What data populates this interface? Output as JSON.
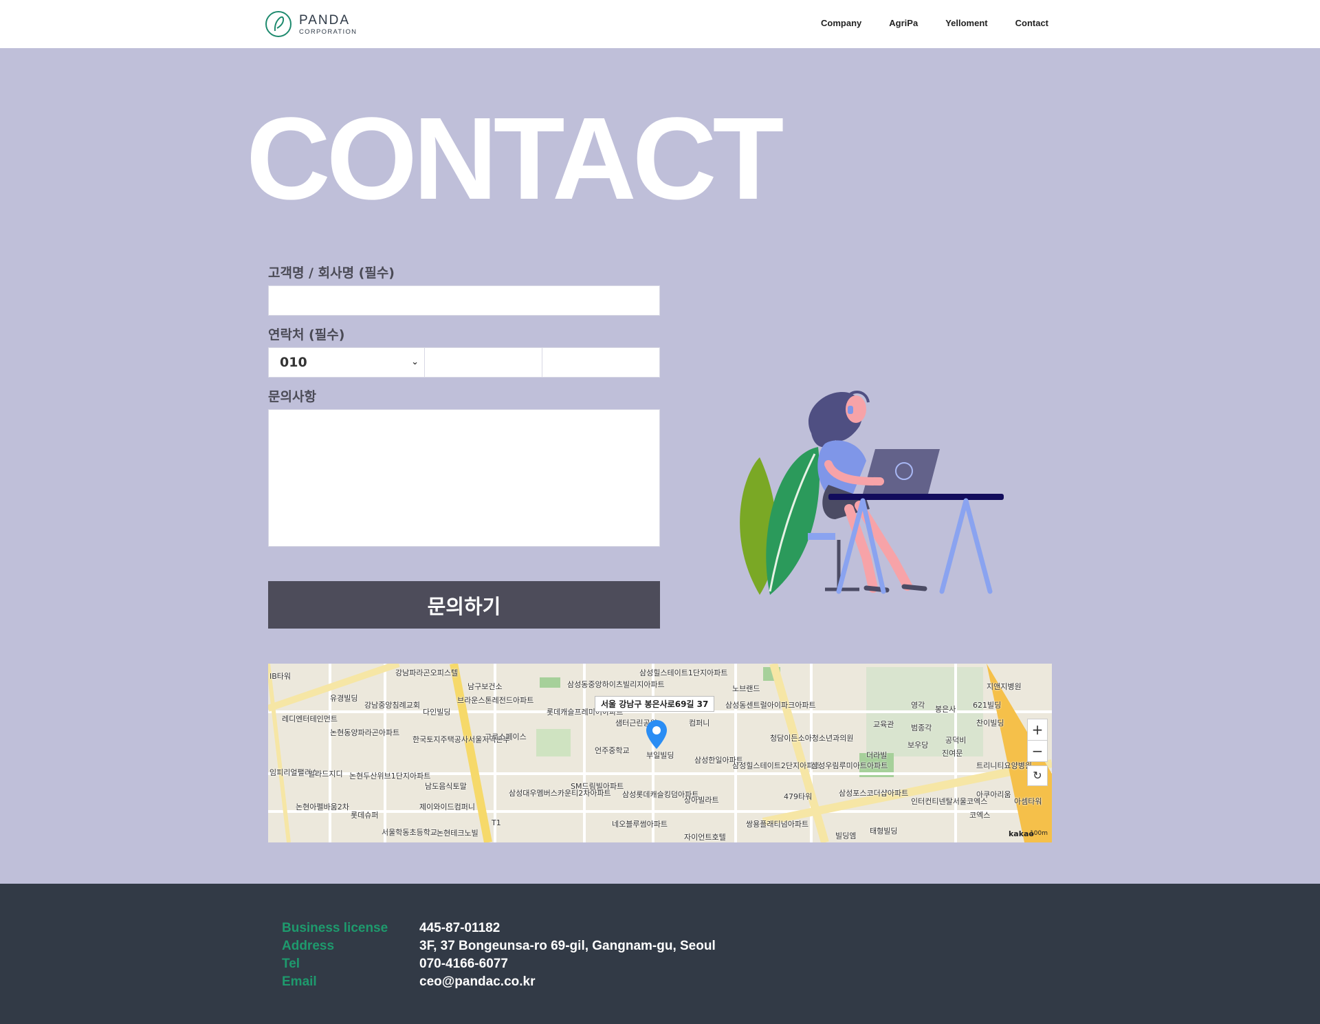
{
  "header": {
    "logo_name": "PANDA",
    "logo_sub": "CORPORATION",
    "nav": [
      "Company",
      "AgriPa",
      "Yelloment",
      "Contact"
    ]
  },
  "hero": {
    "title": "CONTACT"
  },
  "form": {
    "name_label": "고객명 / 회사명 (필수)",
    "name_value": "",
    "phone_label": "연락처 (필수)",
    "phone_prefix": "010",
    "phone_mid": "",
    "phone_last": "",
    "message_label": "문의사항",
    "message_value": "",
    "submit_label": "문의하기"
  },
  "map": {
    "address_bubble": "서울 강남구 봉은사로69길 37",
    "marker_label": "부일빌딩",
    "labels": [
      "IB타워",
      "유경빌딩",
      "강남중앙침례교회",
      "강남파라곤오피스텔",
      "남구보건소",
      "브라운스톤레전드아파트",
      "다인빌딩",
      "삼성동중앙하이츠빌리지아파트",
      "삼성힐스테이트1단지아파트",
      "노브랜드",
      "삼성동센트럴아이파크아파트",
      "레디엔터테인먼트",
      "논현동양파라곤아파트",
      "롯데캐슬프레미어아파트",
      "샘터근린공원",
      "컴퍼니",
      "한국토지주택공사서울지역본부",
      "그로스페이스",
      "언주중학교",
      "청담이든소아청소년과의원",
      "더라빌",
      "영각",
      "봉은사",
      "621빌딩",
      "지앤지병원",
      "찬이빌딩",
      "교육관",
      "범종각",
      "보우당",
      "공덕비",
      "진여문",
      "트리니티요양병원",
      "임피리얼팰리스",
      "빌라드지디",
      "논현두산위브1단지아파트",
      "남도음식토말",
      "삼성한일아파트",
      "삼성힐스테이트2단지아파트",
      "삼성우림루미아트아파트",
      "SM드림빌아파트",
      "삼성대우멤버스카운티2차아파트",
      "삼성롯데캐슬킹덤아파트",
      "상아빌라트",
      "479타워",
      "삼성포스코더샵아파트",
      "인터컨티넨탈서울코엑스",
      "아쿠아리움",
      "아셈타워",
      "코엑스",
      "논현아펠바움2차",
      "롯데슈퍼",
      "제이와이드컴퍼니",
      "서울학동초등학교",
      "논현테크노빌",
      "네오블루썸아파트",
      "자이언트호텔",
      "쌍용플래티넘아파트",
      "빌딩엠",
      "태형빌딩",
      "T1"
    ],
    "kakao": "kakao",
    "scale": "100m",
    "zoom_in": "+",
    "zoom_out": "−",
    "refresh": "↻"
  },
  "footer": {
    "rows": [
      {
        "key": "Business license",
        "value": "445-87-01182"
      },
      {
        "key": "Address",
        "value": "3F, 37 Bongeunsa-ro 69-gil, Gangnam-gu, Seoul"
      },
      {
        "key": "Tel",
        "value": "070-4166-6077"
      },
      {
        "key": "Email",
        "value": "ceo@pandac.co.kr"
      }
    ]
  },
  "colors": {
    "background": "#bfbfd9",
    "submit_button": "#4d4c5a",
    "footer": "#323a46",
    "footer_key": "#1e9a6d",
    "logo": "#1e8a6e"
  }
}
